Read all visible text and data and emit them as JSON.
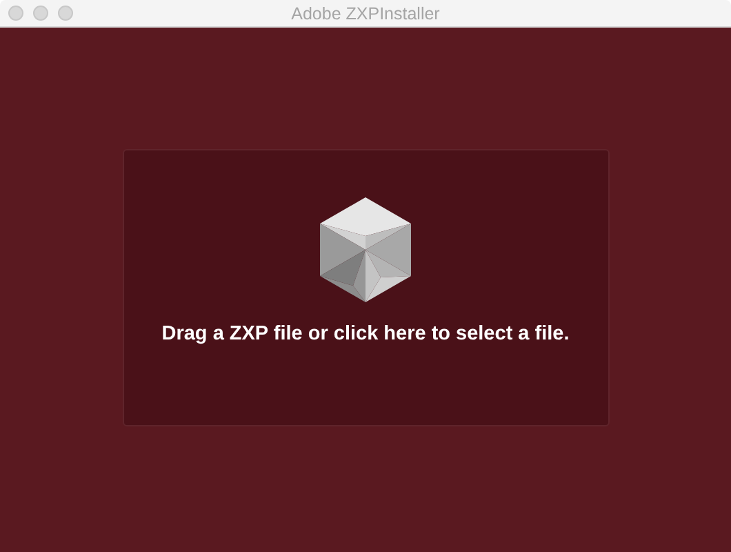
{
  "window": {
    "title": "Adobe ZXPInstaller"
  },
  "drop_zone": {
    "prompt": "Drag a ZXP file or click here to select a file."
  }
}
